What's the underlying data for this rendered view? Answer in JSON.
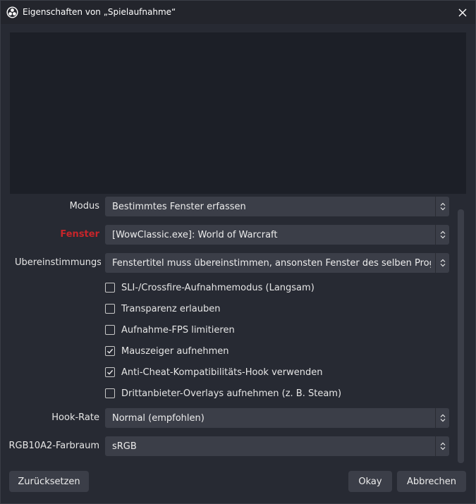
{
  "window": {
    "title": "Eigenschaften von „Spielaufnahme“",
    "icon": "obs-logo-icon",
    "close_icon": "close-icon"
  },
  "form": {
    "modus": {
      "label": "Modus",
      "value": "Bestimmtes Fenster erfassen"
    },
    "fenster": {
      "label": "Fenster",
      "value": "[WowClassic.exe]: World of Warcraft",
      "label_color": "#c8252a"
    },
    "uebereinstimmung": {
      "label": "Übereinstimmungsp",
      "value": "Fenstertitel muss übereinstimmen, ansonsten Fenster des selben Programms"
    },
    "checkboxes": [
      {
        "label": "SLI-/Crossfire-Aufnahmemodus (Langsam)",
        "checked": false
      },
      {
        "label": "Transparenz erlauben",
        "checked": false
      },
      {
        "label": "Aufnahme-FPS limitieren",
        "checked": false
      },
      {
        "label": "Mauszeiger aufnehmen",
        "checked": true
      },
      {
        "label": "Anti-Cheat-Kompatibilitäts-Hook verwenden",
        "checked": true
      },
      {
        "label": "Drittanbieter-Overlays aufnehmen (z. B. Steam)",
        "checked": false
      }
    ],
    "hook_rate": {
      "label": "Hook-Rate",
      "value": "Normal (empfohlen)"
    },
    "farbraum": {
      "label": "RGB10A2-Farbraum",
      "value": "sRGB"
    }
  },
  "buttons": {
    "reset": "Zurücksetzen",
    "ok": "Okay",
    "cancel": "Abbrechen"
  },
  "colors": {
    "background": "#272a33",
    "control": "#3b3e48",
    "error_label": "#c8252a"
  }
}
